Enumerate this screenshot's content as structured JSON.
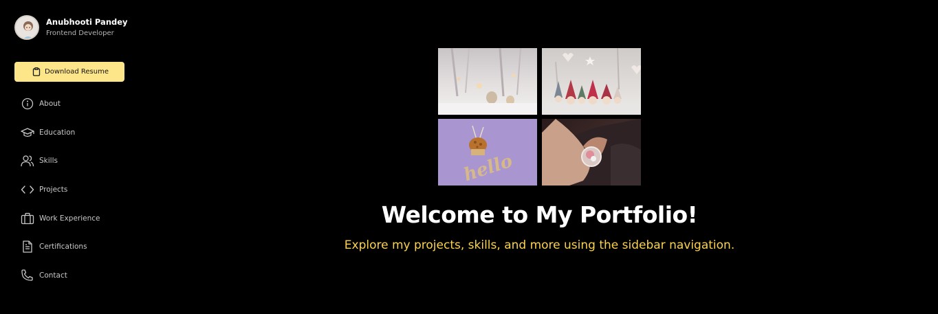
{
  "profile": {
    "name": "Anubhooti Pandey",
    "role": "Frontend Developer"
  },
  "actions": {
    "download_label": "Download Resume"
  },
  "nav": {
    "items": [
      {
        "label": "About",
        "icon": "info-icon"
      },
      {
        "label": "Education",
        "icon": "graduation-cap-icon"
      },
      {
        "label": "Skills",
        "icon": "users-icon"
      },
      {
        "label": "Projects",
        "icon": "code-icon"
      },
      {
        "label": "Work Experience",
        "icon": "briefcase-icon"
      },
      {
        "label": "Certifications",
        "icon": "document-icon"
      },
      {
        "label": "Contact",
        "icon": "phone-icon"
      }
    ]
  },
  "hero": {
    "title": "Welcome to My Portfolio!",
    "subtitle": "Explore my projects, skills, and more using the sidebar navigation.",
    "photo_text": "hello"
  },
  "colors": {
    "background": "#000000",
    "accent": "#fde68a",
    "subtitle": "#fcd34d"
  }
}
